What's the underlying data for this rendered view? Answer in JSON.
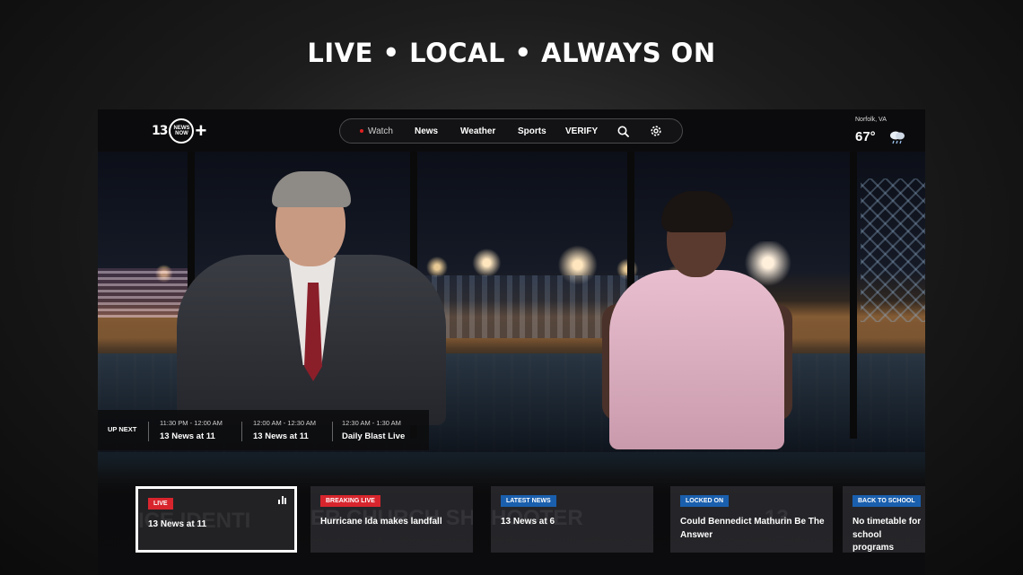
{
  "headline": "LIVE • LOCAL • ALWAYS ON",
  "logo": {
    "number": "13",
    "ring_top": "NEWS",
    "ring_bottom": "NOW",
    "plus": "+"
  },
  "nav": {
    "items": [
      {
        "label": "Watch",
        "active": true
      },
      {
        "label": "News",
        "active": false
      },
      {
        "label": "Weather",
        "active": false
      },
      {
        "label": "Sports",
        "active": false
      },
      {
        "label": "VERIFY",
        "active": false
      }
    ],
    "search_icon": "search-icon",
    "settings_icon": "gear-icon"
  },
  "weather": {
    "location": "Norfolk, VA",
    "temperature": "67°",
    "icon": "cloud-rain-icon"
  },
  "up_next": {
    "label": "UP NEXT",
    "slots": [
      {
        "time": "11:30 PM - 12:00 AM",
        "title": "13 News at 11"
      },
      {
        "time": "12:00 AM - 12:30 AM",
        "title": "13 News at 11"
      },
      {
        "time": "12:30 AM - 1:30 AM",
        "title": "Daily Blast Live"
      }
    ]
  },
  "cards": [
    {
      "badge": "LIVE",
      "badge_color": "#d8252d",
      "title": "13 News at 11",
      "focused": true,
      "bg_text": "ICE IDENTI",
      "show_bars": true
    },
    {
      "badge": "BREAKING LIVE",
      "badge_color": "#d8252d",
      "title": "Hurricane Ida makes landfall",
      "focused": false,
      "bg_text": "ER CHURCH SHOOTER"
    },
    {
      "badge": "LATEST NEWS",
      "badge_color": "#1a5fae",
      "title": "13 News at 6",
      "focused": false,
      "bg_text": "HOOTER"
    },
    {
      "badge": "LOCKED ON",
      "badge_color": "#1a5fae",
      "title": "Could Bennedict Mathurin Be The Answer",
      "focused": false,
      "bg_text": "13"
    },
    {
      "badge": "BACK TO SCHOOL",
      "badge_color": "#1a5fae",
      "title": "No timetable for school programs",
      "focused": false,
      "bg_text": ""
    }
  ]
}
